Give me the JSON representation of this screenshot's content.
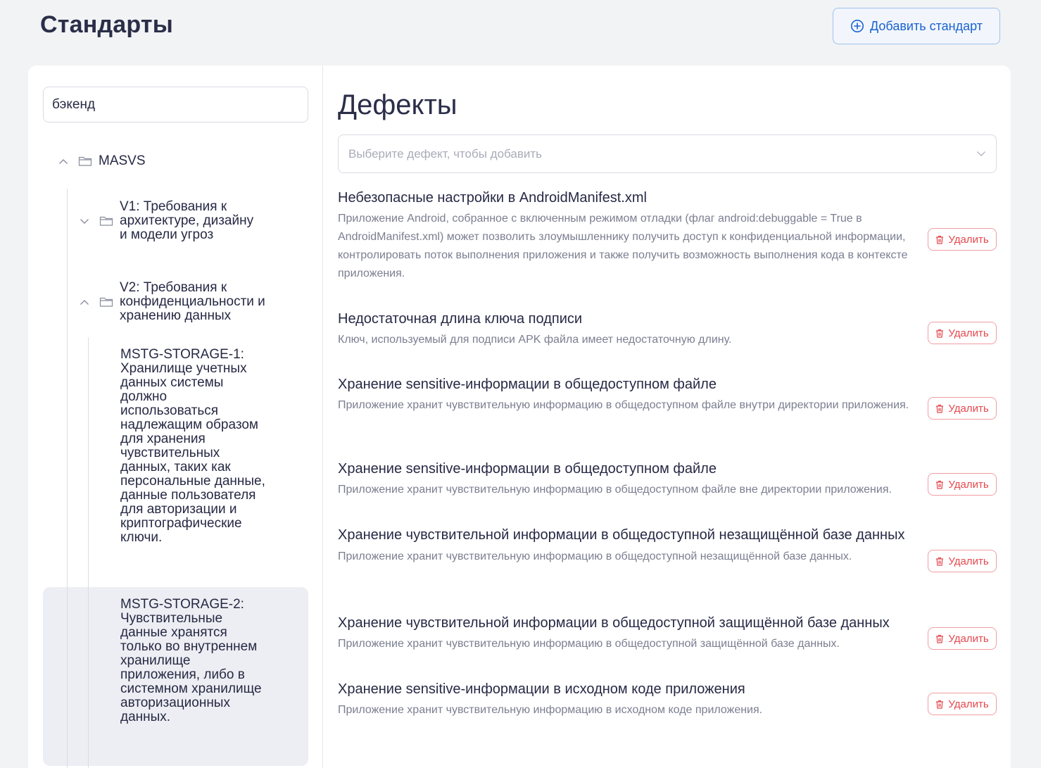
{
  "header": {
    "title": "Стандарты",
    "add_button_label": "Добавить стандарт"
  },
  "sidebar": {
    "search_value": "бэкенд",
    "tree": {
      "root_label": "MASVS",
      "v1_label": "V1: Требования к архитектуре, дизайну и модели угроз",
      "v2_label": "V2: Требования к конфиденциальности и хранению данных",
      "storage1_label": "MSTG-STORAGE-1: Хранилище учетных данных системы должно использоваться надлежащим образом для хранения чувствительных данных, таких как персональные данные, данные пользователя для авторизации и криптографические ключи.",
      "storage2_label": "MSTG-STORAGE-2: Чувствительные данные хранятся только во внутреннем хранилище приложения, либо в системном хранилище авторизационных данных."
    }
  },
  "main": {
    "title": "Дефекты",
    "select_placeholder": "Выберите дефект, чтобы добавить",
    "delete_label": "Удалить",
    "defects": [
      {
        "title": "Небезопасные настройки в AndroidManifest.xml",
        "description": "Приложение Android, собранное с включенным режимом отладки (флаг android:debuggable = True в AndroidManifest.xml) может позволить злоумышленнику получить доступ к конфиденциальной информации, контролировать поток выполнения приложения и также получить возможность выполнения кода в контексте приложения."
      },
      {
        "title": "Недостаточная длина ключа подписи",
        "description": "Ключ, используемый для подписи APK файла имеет недостаточную длину."
      },
      {
        "title": "Хранение sensitive-информации в общедоступном файле",
        "description": "Приложение хранит чувствительную информацию в общедоступном файле внутри директории приложения."
      },
      {
        "title": "Хранение sensitive-информации в общедоступном файле",
        "description": "Приложение хранит чувствительную информацию в общедоступном файле вне директории приложения."
      },
      {
        "title": "Хранение чувствительной информации в общедоступной незащищённой базе данных",
        "description": "Приложение хранит чувствительную информацию в общедоступной незащищённой базе данных."
      },
      {
        "title": "Хранение чувствительной информации в общедоступной защищённой базе данных",
        "description": "Приложение хранит чувствительную информацию в общедоступной защищённой базе данных."
      },
      {
        "title": "Хранение sensitive-информации в исходном коде приложения",
        "description": "Приложение хранит чувствительную информацию в исходном коде приложения."
      }
    ]
  },
  "colors": {
    "accent": "#1a63d1",
    "danger": "#e5484d",
    "text": "#262944",
    "muted": "#7b7e90",
    "background": "#f2f3f5"
  }
}
